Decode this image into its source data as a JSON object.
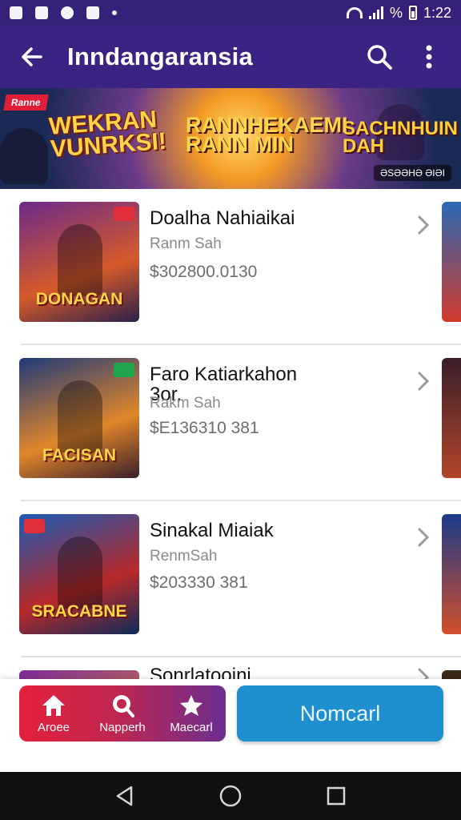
{
  "status_bar": {
    "icons": [
      "photo-icon",
      "bug-icon",
      "sync-icon",
      "store-icon",
      "dot-icon"
    ],
    "battery_text": "%",
    "time": "1:22"
  },
  "app_bar": {
    "back_icon": "arrow-left-icon",
    "title": "Inndangaransia",
    "search_icon": "search-icon",
    "menu_icon": "more-vert-icon"
  },
  "banner": {
    "tag": "Ranne",
    "left_text": "WEKRAN VUNRKSI!",
    "mid_text": "RANNHEKAEMI RANN MIN",
    "right_text": "SACHNHUIN DAH",
    "badge": "ƏSƏƏHƏ ƏIƏI"
  },
  "items": [
    {
      "title": "Doalha Nahiaikai",
      "subtitle": "Ranm Sah",
      "price": "$302800.0130",
      "thumb_label": "DONAGAN",
      "colors": [
        "#6b2a8a",
        "#d65a2a",
        "#2a1f4a"
      ]
    },
    {
      "title": "Faro Katiarkahon 3or.",
      "subtitle": "Rakm Sah",
      "price": "$E136310 381",
      "thumb_label": "FACISAN",
      "colors": [
        "#1f3a7a",
        "#e0862a",
        "#3a1f2a"
      ]
    },
    {
      "title": "Sinakal Miaiak",
      "subtitle": "RenmSah",
      "price": "$203330 381",
      "thumb_label": "SRACABNE",
      "colors": [
        "#1a5ab5",
        "#b82a2a",
        "#0f2a5a"
      ]
    },
    {
      "title": "Sonrlatooini",
      "subtitle": "",
      "price": "",
      "thumb_label": "",
      "colors": [
        "#7a2a9a",
        "#e08a3a",
        "#3a1a4a"
      ]
    }
  ],
  "bottom_tabs": [
    {
      "label": "Aroee",
      "icon": "home-icon"
    },
    {
      "label": "Napperh",
      "icon": "search-icon"
    },
    {
      "label": "Maecarl",
      "icon": "star-icon"
    }
  ],
  "primary_button": "Nomcarl",
  "nav_bar": {
    "back_icon": "nav-back-icon",
    "home_icon": "nav-home-icon",
    "recents_icon": "nav-recents-icon"
  }
}
